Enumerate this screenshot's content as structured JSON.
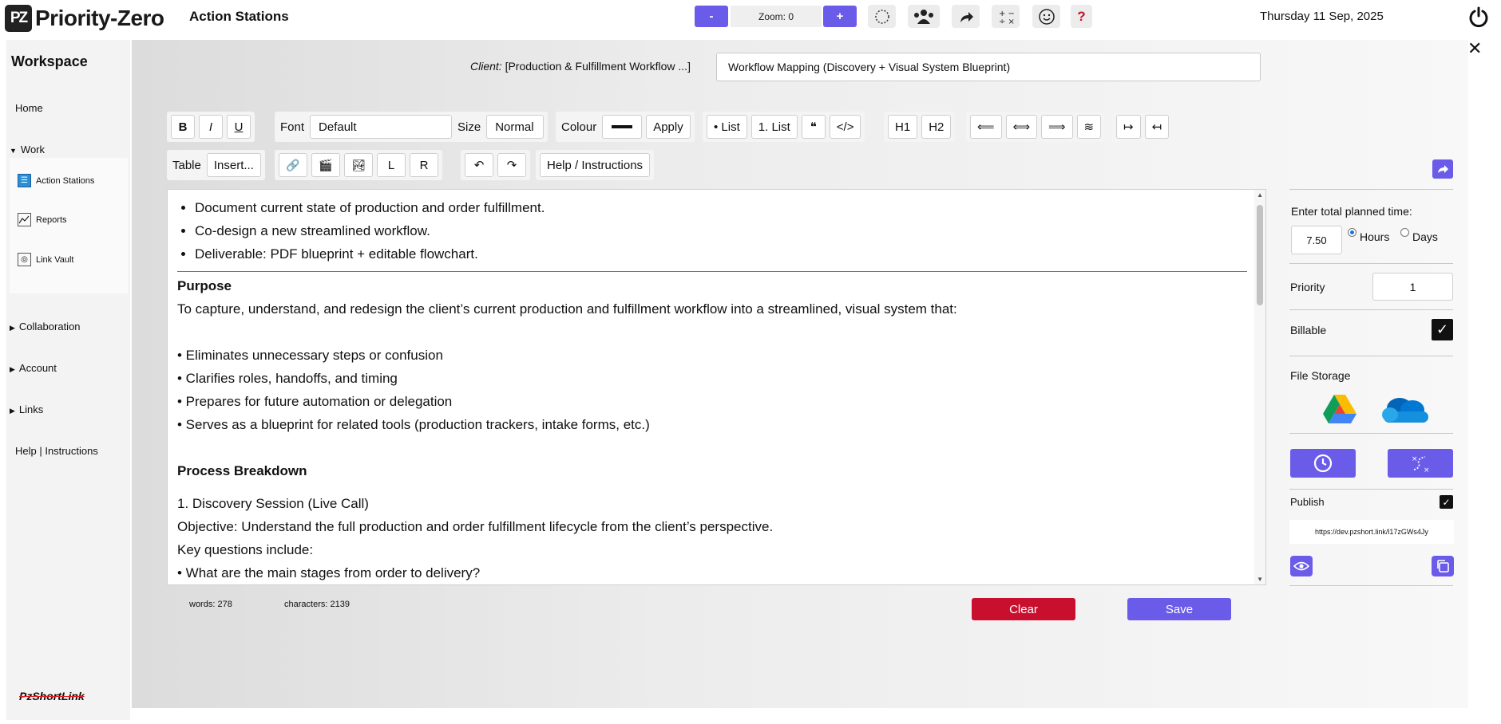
{
  "app": {
    "logo_mark": "PZ",
    "name": "Priority-Zero",
    "page_name": "Action Stations"
  },
  "topbar": {
    "zoom_minus": "-",
    "zoom_label": "Zoom: 0",
    "zoom_plus": "+",
    "date": "Thursday 11 Sep, 2025",
    "icons": [
      "spinner-icon",
      "team-icon",
      "share-arrow-icon",
      "calculator-icon",
      "smiley-icon",
      "help-icon"
    ],
    "help_glyph": "?"
  },
  "sidebar": {
    "title": "Workspace",
    "home": "Home",
    "work": "Work",
    "work_items": [
      "Action Stations",
      "Reports",
      "Link Vault"
    ],
    "collaboration": "Collaboration",
    "account": "Account",
    "links": "Links",
    "help": "Help | Instructions",
    "bottom_logo": "PzShortLink"
  },
  "header": {
    "client_prefix": "Client:",
    "client_value": "[Production & Fulfillment Workflow ...]",
    "title_value": "Workflow Mapping (Discovery + Visual System Blueprint)"
  },
  "toolbar": {
    "bold": "B",
    "italic": "I",
    "underline": "U",
    "font_label": "Font",
    "font_value": "Default",
    "size_label": "Size",
    "size_value": "Normal",
    "colour_label": "Colour",
    "apply": "Apply",
    "bullet_list": "• List",
    "number_list": "1. List",
    "quote": "❝",
    "code": "</>",
    "h1": "H1",
    "h2": "H2",
    "align_left": "⟸",
    "align_center": "⟺",
    "align_right": "⟹",
    "collapse": "≋",
    "indent": "↦",
    "outdent": "↤",
    "table_label": "Table",
    "insert": "Insert...",
    "link": "🔗",
    "video": "🎬",
    "image": "🏞",
    "float_left": "L",
    "float_right": "R",
    "undo": "↶",
    "redo": "↷",
    "help": "Help / Instructions"
  },
  "editor": {
    "bullets": [
      "Document current state of production and order fulfillment.",
      "Co-design a new streamlined workflow.",
      "Deliverable: PDF blueprint + editable flowchart."
    ],
    "purpose_heading": "Purpose",
    "purpose_text": "To capture, understand, and redesign the client’s current production and fulfillment workflow into a streamlined, visual system that:",
    "purpose_points": [
      "• Eliminates unnecessary steps or confusion",
      "• Clarifies roles, handoffs, and timing",
      "• Prepares for future automation or delegation",
      "• Serves as a blueprint for related tools (production trackers, intake forms, etc.)"
    ],
    "breakdown_heading": "Process Breakdown",
    "step1": "1. Discovery Session (Live Call)",
    "objective": "Objective: Understand the full production and order fulfillment lifecycle from the client’s perspective.",
    "key_questions": "Key questions include:",
    "question1": "• What are the main stages from order to delivery?"
  },
  "footer": {
    "words": "words: 278",
    "characters": "characters: 2139",
    "clear": "Clear",
    "save": "Save"
  },
  "panel": {
    "planned_time_label": "Enter total planned time:",
    "planned_time_value": "7.50",
    "hours": "Hours",
    "days": "Days",
    "priority_label": "Priority",
    "priority_value": "1",
    "billable_label": "Billable",
    "billable_checked": true,
    "file_storage_label": "File Storage",
    "publish_label": "Publish",
    "publish_checked": true,
    "publish_url": "https://dev.pzshort.link/l17zGWs4Jy"
  },
  "colors": {
    "accent": "#6a5ce8",
    "danger": "#c8102e"
  }
}
